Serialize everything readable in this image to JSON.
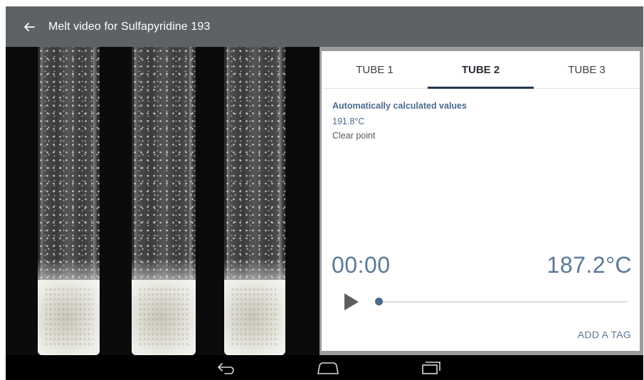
{
  "appbar": {
    "title": "Melt video for Sulfapyridine 193",
    "back_icon": "arrow-left-icon"
  },
  "tabs": [
    {
      "label": "TUBE 1",
      "active": false
    },
    {
      "label": "TUBE 2",
      "active": true
    },
    {
      "label": "TUBE 3",
      "active": false
    }
  ],
  "results": {
    "heading": "Automatically calculated values",
    "value": "191.8°C",
    "label": "Clear point"
  },
  "player": {
    "time": "00:00",
    "temperature": "187.2°C",
    "progress": 0,
    "play_icon": "play-icon"
  },
  "actions": {
    "add_tag": "ADD A TAG"
  },
  "nav": {
    "back_icon": "nav-back-icon",
    "home_icon": "nav-home-icon",
    "recents_icon": "nav-recents-icon"
  },
  "colors": {
    "appbar": "#5f6265",
    "accent": "#5b7896",
    "tab_indicator": "#1f3550"
  }
}
